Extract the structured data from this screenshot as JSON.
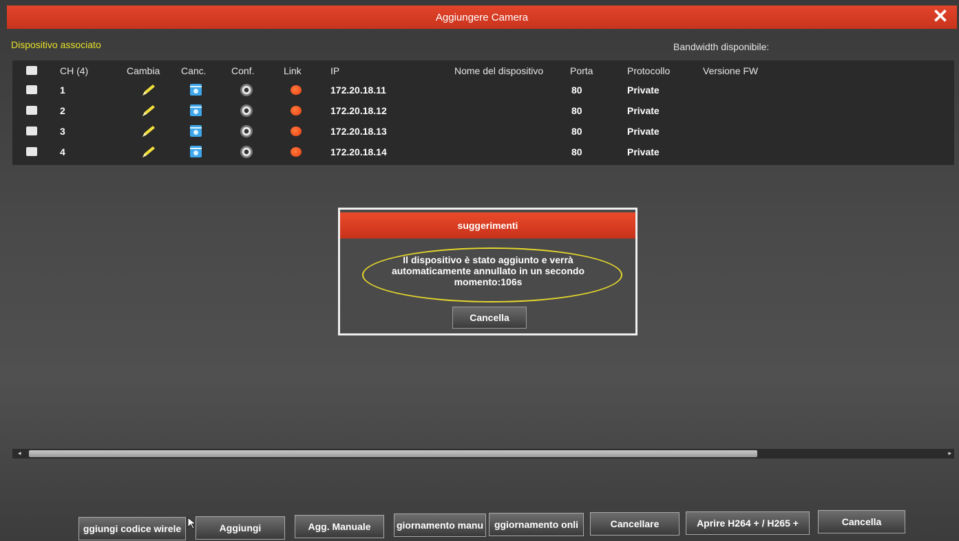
{
  "window": {
    "title": "Aggiungere Camera",
    "close_label": "✕"
  },
  "section_title": "Dispositivo associato",
  "bandwidth_label": "Bandwidth disponibile:",
  "table": {
    "headers": {
      "ch": "CH (4)",
      "cambia": "Cambia",
      "canc": "Canc.",
      "conf": "Conf.",
      "link": "Link",
      "ip": "IP",
      "nome": "Nome del dispositivo",
      "porta": "Porta",
      "protocollo": "Protocollo",
      "versione": "Versione FW"
    },
    "rows": [
      {
        "ch": "1",
        "ip": "172.20.18.11",
        "porta": "80",
        "protocollo": "Private"
      },
      {
        "ch": "2",
        "ip": "172.20.18.12",
        "porta": "80",
        "protocollo": "Private"
      },
      {
        "ch": "3",
        "ip": "172.20.18.13",
        "porta": "80",
        "protocollo": "Private"
      },
      {
        "ch": "4",
        "ip": "172.20.18.14",
        "porta": "80",
        "protocollo": "Private"
      }
    ],
    "icons": {
      "edit": "pencil-icon",
      "delete": "trash-icon",
      "config": "eye-icon",
      "link": "link-status-dot"
    },
    "link_color": "#ec3e12"
  },
  "dialog": {
    "title": "suggerimenti",
    "message_line1": "Il dispositivo è stato aggiunto e verrà",
    "message_line2": "automaticamente annullato in un secondo",
    "message_line3": "momento:106s",
    "button": "Cancella"
  },
  "buttons": {
    "wireless": "ggiungi codice wirele",
    "aggiungi": "Aggiungi",
    "manuale": "Agg. Manuale",
    "agg_manuale_update": "giornamento manu",
    "agg_online": "ggiornamento onli",
    "cancellare": "Cancellare",
    "h264": "Aprire H264 + / H265 +",
    "cancella": "Cancella"
  },
  "colors": {
    "accent": "#d63a22",
    "section_title": "#e8e22a",
    "highlight_ring": "#e7d92b"
  }
}
